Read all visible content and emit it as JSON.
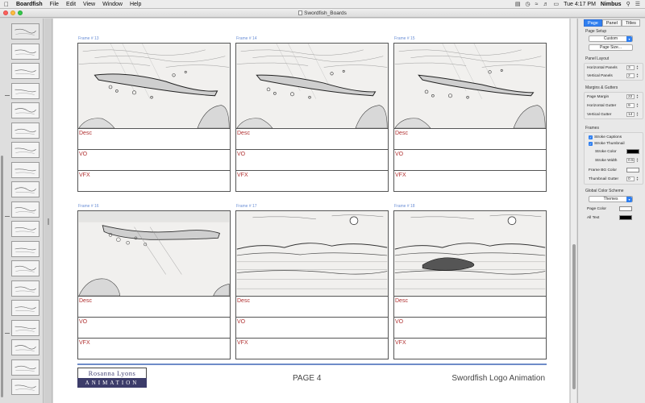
{
  "menubar": {
    "app": "Boardfish",
    "items": [
      "File",
      "Edit",
      "View",
      "Window",
      "Help"
    ],
    "clock": "Tue 4:17 PM",
    "user": "Nimbus"
  },
  "window": {
    "title": "Swordfish_Boards"
  },
  "frames": [
    {
      "title": "Frame # 13",
      "desc": "Desc",
      "vo": "VO",
      "vfx": "VFX"
    },
    {
      "title": "Frame # 14",
      "desc": "Desc",
      "vo": "VO",
      "vfx": "VFX"
    },
    {
      "title": "Frame # 15",
      "desc": "Desc",
      "vo": "VO",
      "vfx": "VFX"
    },
    {
      "title": "Frame # 16",
      "desc": "Desc",
      "vo": "VO",
      "vfx": "VFX"
    },
    {
      "title": "Frame # 17",
      "desc": "Desc",
      "vo": "VO",
      "vfx": "VFX"
    },
    {
      "title": "Frame # 18",
      "desc": "Desc",
      "vo": "VO",
      "vfx": "VFX"
    }
  ],
  "footer": {
    "logo_top": "Rosanna Lyons",
    "logo_bottom": "ANIMATION",
    "page": "PAGE 4",
    "project": "Swordfish Logo Animation"
  },
  "inspector": {
    "tabs": [
      "Page",
      "Panel",
      "Titles"
    ],
    "active_tab": "Page",
    "page_setup": {
      "label": "Page Setup",
      "preset": "Custom",
      "page_size_button": "Page Size..."
    },
    "panel_layout": {
      "label": "Panel Layout",
      "horizontal_label": "Horizontal Panels",
      "horizontal": "3",
      "vertical_label": "Vertical Panels",
      "vertical": "2"
    },
    "margins": {
      "label": "Margins & Gutters",
      "page_margin_label": "Page Margin",
      "page_margin": "22",
      "h_gutter_label": "Horizontal Gutter",
      "h_gutter": "9",
      "v_gutter_label": "Vertical Gutter",
      "v_gutter": "14"
    },
    "frames": {
      "label": "Frames",
      "stroke_captions": "Stroke Captions",
      "stroke_thumbnail": "Stroke Thumbnail",
      "stroke_color_label": "Stroke Color",
      "stroke_color": "#000000",
      "stroke_width_label": "Stroke Width",
      "stroke_width": "0.5",
      "frame_bg_label": "Frame BG Color",
      "frame_bg": "#ffffff",
      "thumb_gutter_label": "Thumbnail Gutter",
      "thumb_gutter": "0"
    },
    "color_scheme": {
      "label": "Global Color Scheme",
      "themes": "Themes",
      "page_color_label": "Page Color",
      "page_color": "#ffffff",
      "all_text_label": "All Text",
      "all_text": "#000000"
    }
  },
  "colors": {
    "accent": "#2f7ff0",
    "frame_title": "#6b8fd6",
    "caption_text": "#b03030",
    "footer_rule": "#6e8cc8",
    "logo_band": "#3c3c6a"
  }
}
